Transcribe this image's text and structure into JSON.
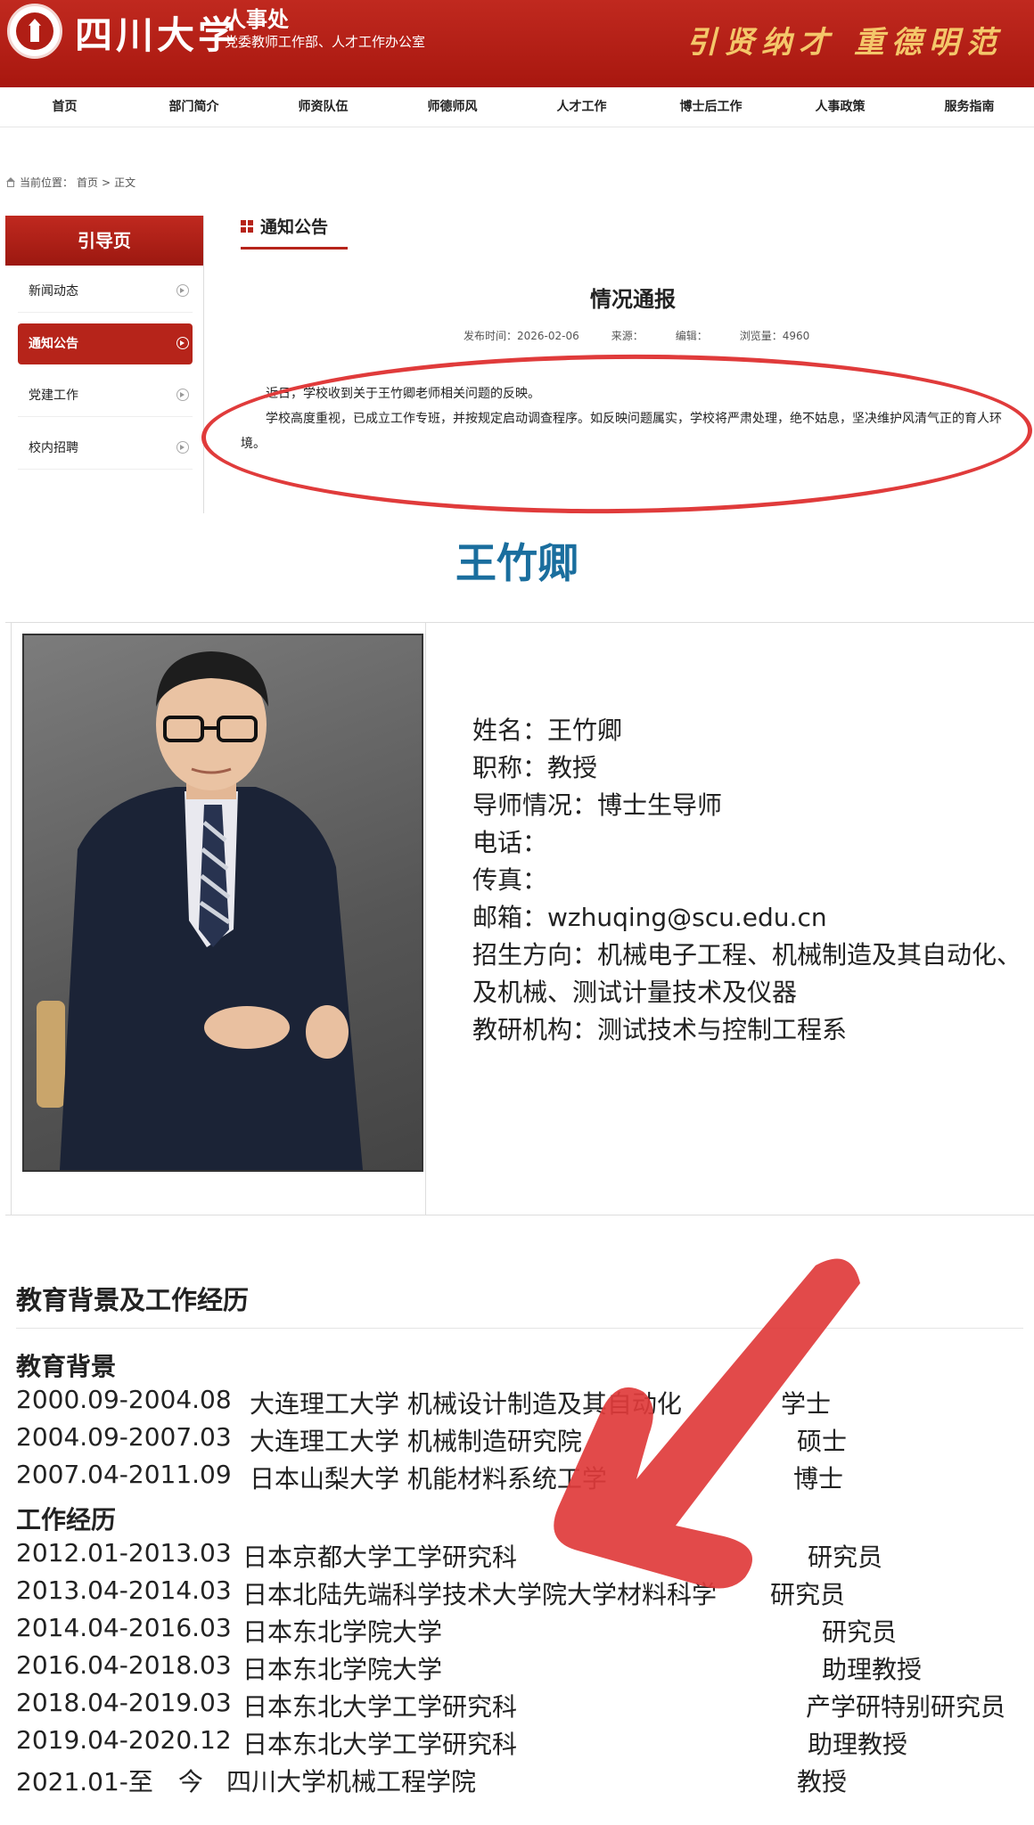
{
  "header": {
    "university": "四川大学",
    "department": "人事处",
    "department_sub": "党委教师工作部、人才工作办公室",
    "slogan": "引贤纳才 重德明范"
  },
  "nav": [
    "首页",
    "部门简介",
    "师资队伍",
    "师德师风",
    "人才工作",
    "博士后工作",
    "人事政策",
    "服务指南"
  ],
  "breadcrumb": {
    "prefix": "当前位置：",
    "home": "首页",
    "separator": ">",
    "current": "正文"
  },
  "sidebar": {
    "heading": "引导页",
    "items": [
      {
        "label": "新闻动态",
        "active": false
      },
      {
        "label": "通知公告",
        "active": true
      },
      {
        "label": "党建工作",
        "active": false
      },
      {
        "label": "校内招聘",
        "active": false
      }
    ]
  },
  "notice": {
    "tab": "通知公告",
    "title": "情况通报",
    "meta": {
      "date": "发布时间：2026-02-06",
      "source": "来源：",
      "editor": "编辑：",
      "views": "浏览量：4960"
    },
    "paragraphs": [
      "近日，学校收到关于王竹卿老师相关问题的反映。",
      "学校高度重视，已成立工作专班，并按规定启动调查程序。如反映问题属实，学校将严肃处理，绝不姑息，坚决维护风清气正的育人环境。"
    ]
  },
  "profile": {
    "big_name": "王竹卿",
    "fields": [
      "姓名：王竹卿",
      "职称：教授",
      "导师情况：博士生导师",
      "电话：",
      "传真：",
      "邮箱：wzhuqing@scu.edu.cn",
      "招生方向：机械电子工程、机械制造及其自动化、",
      "及机械、测试计量技术及仪器",
      "教研机构：测试技术与控制工程系"
    ]
  },
  "resume": {
    "section_title": "教育背景及工作经历",
    "education_title": "教育背景",
    "education": [
      {
        "period": "2000.09-2004.08",
        "inst": "大连理工大学 机械设计制造及其自动化",
        "degree": "学士"
      },
      {
        "period": "2004.09-2007.03",
        "inst": "大连理工大学 机械制造研究院",
        "degree": "硕士"
      },
      {
        "period": "2007.04-2011.09",
        "inst": "日本山梨大学 机能材料系统工学",
        "degree": "博士"
      }
    ],
    "work_title": "工作经历",
    "work": [
      {
        "period": "2012.01-2013.03",
        "inst": "日本京都大学工学研究科",
        "degree": "研究员"
      },
      {
        "period": "2013.04-2014.03",
        "inst": "日本北陆先端科学技术大学院大学材料科学",
        "degree": "研究员"
      },
      {
        "period": "2014.04-2016.03",
        "inst": "日本东北学院大学",
        "degree": "研究员"
      },
      {
        "period": "2016.04-2018.03",
        "inst": "日本东北学院大学",
        "degree": "助理教授"
      },
      {
        "period": "2018.04-2019.03",
        "inst": "日本东北大学工学研究科",
        "degree": "产学研特别研究员"
      },
      {
        "period": "2019.04-2020.12",
        "inst": "日本东北大学工学研究科",
        "degree": "助理教授"
      },
      {
        "period": "2021.01-至　今",
        "inst": "四川大学机械工程学院",
        "degree": "教授"
      }
    ]
  },
  "colors": {
    "brand_red": "#b6241a",
    "slogan_gold": "#f4c76a",
    "name_blue": "#1a6e9e",
    "annotation_red": "#e03b3b"
  },
  "icons": [
    "logo-seal-icon",
    "home-icon",
    "chevron-right-circle-icon",
    "grid-icon",
    "annotation-arrow-icon"
  ]
}
